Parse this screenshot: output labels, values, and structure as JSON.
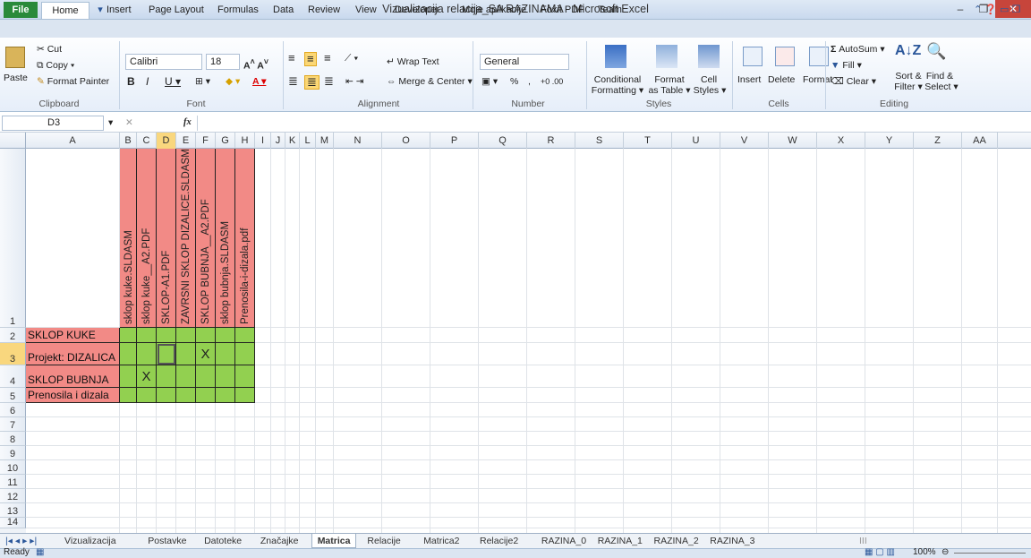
{
  "window": {
    "title": "Vizualizacija relacija_SA RAZINAMA - Microsoft Excel"
  },
  "tabs": [
    "File",
    "Home",
    "Insert",
    "Page Layout",
    "Formulas",
    "Data",
    "Review",
    "View",
    "Developer",
    "Moje aplikacije",
    "Foxit PDF",
    "Team"
  ],
  "clipboard": {
    "paste": "Paste",
    "cut": "Cut",
    "copy": "Copy",
    "format_painter": "Format Painter",
    "label": "Clipboard"
  },
  "font": {
    "name": "Calibri",
    "size": "18",
    "label": "Font"
  },
  "alignment": {
    "wrap": "Wrap Text",
    "merge": "Merge & Center",
    "label": "Alignment"
  },
  "number": {
    "format": "General",
    "label": "Number",
    "percent": "%",
    "comma": ","
  },
  "styles": {
    "conditional": "Conditional",
    "conditional2": "Formatting",
    "format_table": "Format",
    "format_table2": "as Table",
    "cell_styles": "Cell",
    "cell_styles2": "Styles",
    "label": "Styles"
  },
  "cells": {
    "insert": "Insert",
    "delete": "Delete",
    "format": "Format",
    "label": "Cells"
  },
  "editing": {
    "autosum": "AutoSum",
    "fill": "Fill",
    "clear": "Clear",
    "sort": "Sort &",
    "sort2": "Filter",
    "find": "Find &",
    "find2": "Select",
    "label": "Editing"
  },
  "formula_bar": {
    "name_box": "D3",
    "fx": "fx",
    "formula": ""
  },
  "columns": [
    "A",
    "B",
    "C",
    "D",
    "E",
    "F",
    "G",
    "H",
    "I",
    "J",
    "K",
    "L",
    "M",
    "N",
    "O",
    "P",
    "Q",
    "R",
    "S",
    "T",
    "U",
    "V",
    "W",
    "X",
    "Y",
    "Z",
    "AA"
  ],
  "rows": [
    "1",
    "2",
    "3",
    "4",
    "5",
    "6",
    "7",
    "8",
    "9",
    "10",
    "11",
    "12",
    "13",
    "14"
  ],
  "header_labels": [
    "sklop kuke.SLDASM",
    "sklop kuke__A2.PDF",
    "SKLOP-A1.PDF",
    "ZAVRSNI SKLOP DIZALICE.SLDASM",
    "SKLOP BUBNJA__A2.PDF",
    "sklop bubnja.SLDASM",
    "Prenosila-i-dizala.pdf"
  ],
  "row_labels": [
    "SKLOP KUKE",
    "Projekt: DIZALICA",
    "SKLOP BUBNJA",
    "Prenosila i dizala"
  ],
  "marks": {
    "row3_F": "X",
    "row4_C": "X"
  },
  "sheets": [
    "Vizualizacija",
    "Postavke",
    "Datoteke",
    "Značajke",
    "Matrica",
    "Relacije",
    "Matrica2",
    "Relacije2",
    "RAZINA_0",
    "RAZINA_1",
    "RAZINA_2",
    "RAZINA_3"
  ],
  "active_sheet": "Matrica",
  "status": {
    "ready": "Ready",
    "zoom": "100%"
  },
  "colors": {
    "header_fill": "#f28a86",
    "matrix_fill": "#92d050",
    "file_tab": "#2a8a3a"
  }
}
